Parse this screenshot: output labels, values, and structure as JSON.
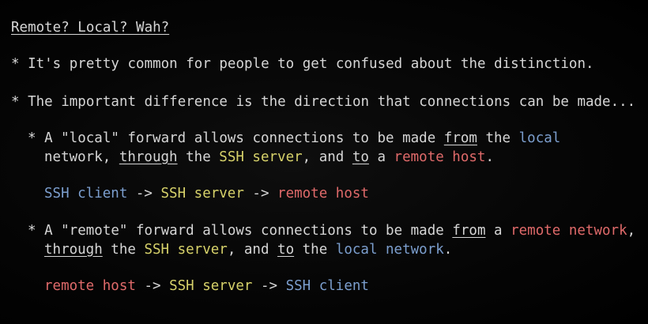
{
  "colors": {
    "background": "#000000",
    "text": "#d6d6d6",
    "local": "#7c9fcf",
    "ssh_server": "#d7d26a",
    "remote": "#e06a6a"
  },
  "slide": {
    "title": "Remote? Local? Wah?",
    "bullet1": "* It's pretty common for people to get confused about the distinction.",
    "bullet2": "* The important difference is the direction that connections can be made...",
    "local_forward": {
      "line1": {
        "p1": "* A \"local\" forward allows connections to be made ",
        "from": "from",
        "p2": " the ",
        "local": "local"
      },
      "line2": {
        "p1": "network, ",
        "through": "through",
        "p2": " the ",
        "ssh_server": "SSH server",
        "p3": ", and ",
        "to": "to",
        "p4": " a ",
        "remote_host": "remote host",
        "p5": "."
      },
      "flow": {
        "client": "SSH client",
        "arrow1": " -> ",
        "server": "SSH server",
        "arrow2": " -> ",
        "remote": "remote host"
      }
    },
    "remote_forward": {
      "line1": {
        "p1": "* A \"remote\" forward allows connections to be made ",
        "from": "from",
        "p2": " a ",
        "remote_network": "remote network",
        "p3": ","
      },
      "line2": {
        "through": "through",
        "p1": " the ",
        "ssh_server": "SSH server",
        "p2": ", and ",
        "to": "to",
        "p3": " the ",
        "local_network": "local network",
        "p4": "."
      },
      "flow": {
        "remote": "remote host",
        "arrow1": " -> ",
        "server": "SSH server",
        "arrow2": " -> ",
        "client": "SSH client"
      }
    }
  }
}
